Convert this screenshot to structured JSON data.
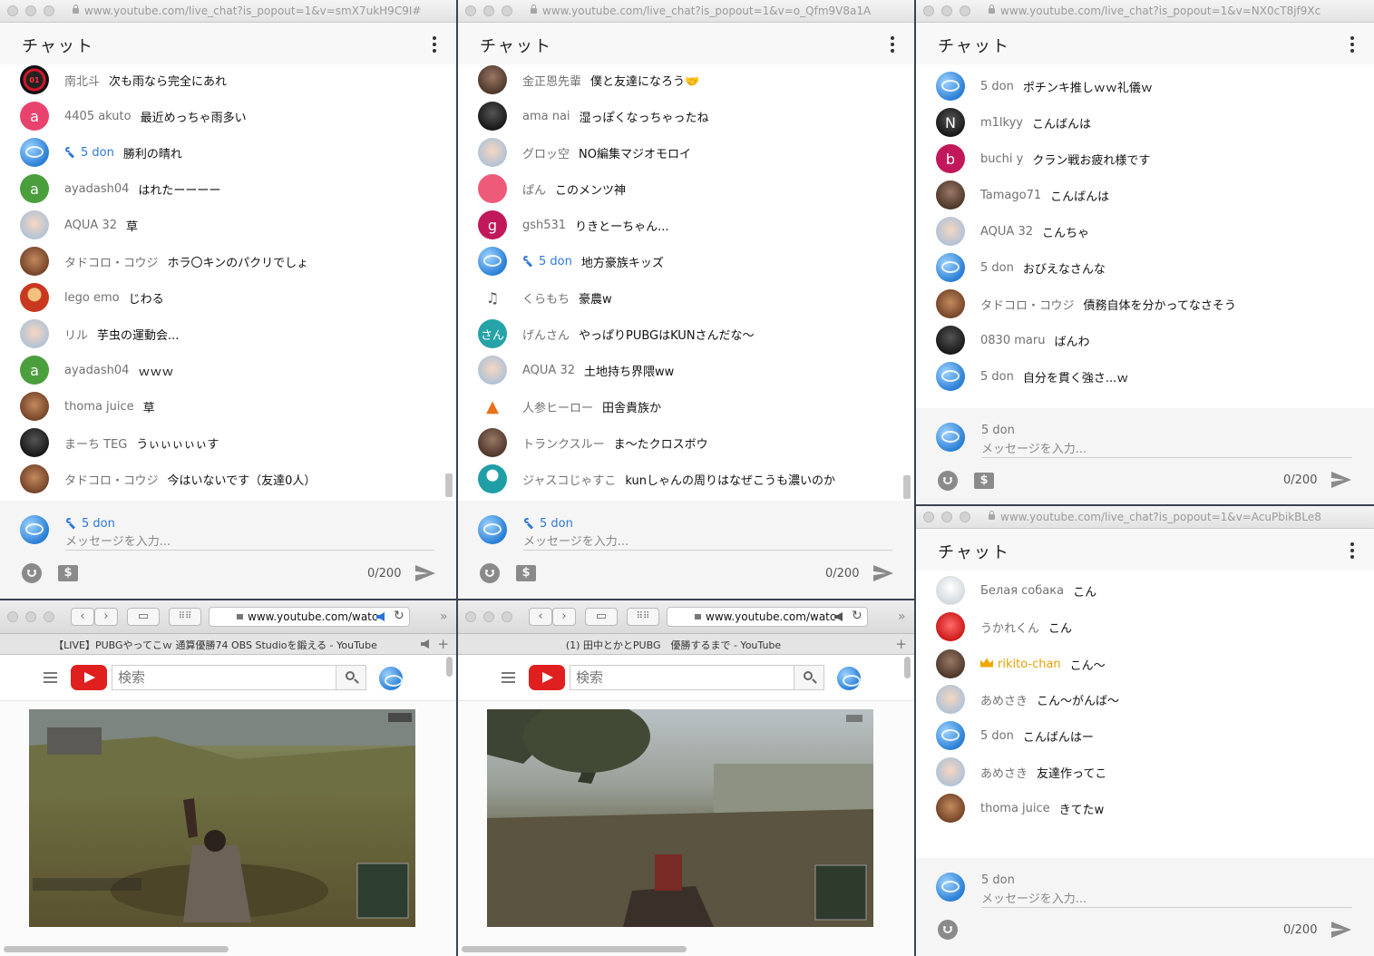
{
  "colors": {
    "moderator": "#2f78d6",
    "member": "#e8a000",
    "youtube_red": "#e0201e"
  },
  "icons": [
    "kebab-menu-icon",
    "wrench-icon",
    "crown-icon",
    "emoji-icon",
    "super-chat-icon",
    "send-icon",
    "search-icon",
    "menu-icon",
    "speaker-icon",
    "reload-icon",
    "lock-icon"
  ],
  "chat1": {
    "url": "www.youtube.com/live_chat?is_popout=1&v=smX7ukH9C9I#",
    "title": "チャット",
    "messages": [
      {
        "author": "南北斗",
        "text": "次も雨なら完全にあれ"
      },
      {
        "author": "4405 akuto",
        "text": "最近めっちゃ雨多い"
      },
      {
        "author": "5 don",
        "text": "勝利の晴れ"
      },
      {
        "author": "ayadash04",
        "text": "はれたーーーー"
      },
      {
        "author": "AQUA 32",
        "text": "草"
      },
      {
        "author": "タドコロ・コウジ",
        "text": "ホラ〇キンのパクリでしょ"
      },
      {
        "author": "lego emo",
        "text": "じわる"
      },
      {
        "author": "リル",
        "text": "芋虫の運動会..."
      },
      {
        "author": "ayadash04",
        "text": "ｗｗｗ"
      },
      {
        "author": "thoma juice",
        "text": "草"
      },
      {
        "author": "まーち TEG",
        "text": "うぃぃぃぃぃす"
      },
      {
        "author": "タドコロ・コウジ",
        "text": "今はいないです（友達0人）"
      }
    ],
    "input": {
      "user": "5 don",
      "placeholder": "メッセージを入力...",
      "counter": "0/200"
    }
  },
  "chat2": {
    "url": "www.youtube.com/live_chat?is_popout=1&v=o_Qfm9V8a1A",
    "title": "チャット",
    "messages": [
      {
        "author": "金正恩先輩",
        "text": "僕と友達になろう🤝"
      },
      {
        "author": "ama nai",
        "text": "湿っぽくなっちゃったね"
      },
      {
        "author": "グロッ空",
        "text": "NO編集マジオモロイ"
      },
      {
        "author": "ぱん",
        "text": "このメンツ神"
      },
      {
        "author": "gsh531",
        "text": "りきとーちゃん..."
      },
      {
        "author": "5 don",
        "text": "地方豪族キッズ"
      },
      {
        "author": "くらもち",
        "text": "豪農w"
      },
      {
        "author": "げんさん",
        "text": "やっぱりPUBGはKUNさんだな〜"
      },
      {
        "author": "AQUA 32",
        "text": "土地持ち界隈ww"
      },
      {
        "author": "人参ヒーロー",
        "text": "田舎貴族か"
      },
      {
        "author": "トランクスルー",
        "text": "ま〜たクロスボウ"
      },
      {
        "author": "ジャスコじゃすこ",
        "text": "kunしゃんの周りはなぜこうも濃いのか"
      }
    ],
    "input": {
      "user": "5 don",
      "placeholder": "メッセージを入力...",
      "counter": "0/200"
    }
  },
  "chat3": {
    "url": "www.youtube.com/live_chat?is_popout=1&v=NX0cT8jf9Xc",
    "title": "チャット",
    "messages": [
      {
        "author": "5 don",
        "text": "ポチンキ推しｗｗ礼儀ｗ"
      },
      {
        "author": "m1lkyy",
        "text": "こんばんは"
      },
      {
        "author": "buchi y",
        "text": "クラン戦お疲れ様です"
      },
      {
        "author": "Tamago71",
        "text": "こんばんは"
      },
      {
        "author": "AQUA 32",
        "text": "こんちゃ"
      },
      {
        "author": "5 don",
        "text": "おびえなさんな"
      },
      {
        "author": "タドコロ・コウジ",
        "text": "債務自体を分かってなさそう"
      },
      {
        "author": "0830 maru",
        "text": "ばんわ"
      },
      {
        "author": "5 don",
        "text": "自分を貫く強さ...ｗ"
      }
    ],
    "input": {
      "user": "5 don",
      "placeholder": "メッセージを入力...",
      "counter": "0/200"
    }
  },
  "chat4": {
    "url": "www.youtube.com/live_chat?is_popout=1&v=AcuPbikBLe8",
    "title": "チャット",
    "messages": [
      {
        "author": "Белая собака",
        "text": "こん"
      },
      {
        "author": "うかれくん",
        "text": "こん"
      },
      {
        "author": "rikito-chan",
        "text": "こん〜"
      },
      {
        "author": "あめさき",
        "text": "こん〜がんば〜"
      },
      {
        "author": "5 don",
        "text": "こんばんはー"
      },
      {
        "author": "あめさき",
        "text": "友達作ってこ"
      },
      {
        "author": "thoma juice",
        "text": "きてたw"
      }
    ],
    "input": {
      "user": "5 don",
      "placeholder": "メッセージを入力...",
      "counter": "0/200"
    }
  },
  "browser1": {
    "address": "www.youtube.com/watc",
    "tab_title": "【LIVE】PUBGやってこｗ 通算優勝74 OBS Studioを鍛える - YouTube",
    "search_placeholder": "検索"
  },
  "browser2": {
    "address": "www.youtube.com/watc",
    "tab_title": "(1) 田中とかとPUBG　優勝するまで - YouTube",
    "search_placeholder": "検索"
  }
}
